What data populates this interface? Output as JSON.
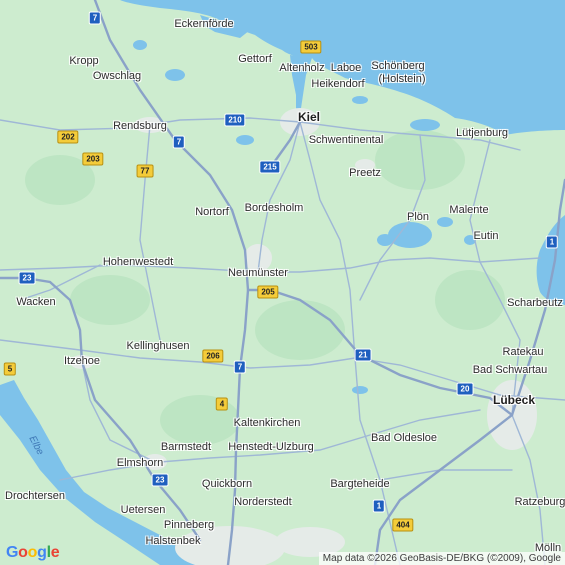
{
  "map": {
    "places": {
      "eckernfoerde": "Eckernförde",
      "kropp": "Kropp",
      "owschlag": "Owschlag",
      "gettorf": "Gettorf",
      "altenholz": "Altenholz",
      "laboe": "Laboe",
      "schoenberg": "Schönberg",
      "schoenberg_sub": "(Holstein)",
      "heikendorf": "Heikendorf",
      "rendsburg": "Rendsburg",
      "kiel": "Kiel",
      "schwentinental": "Schwentinental",
      "luetjenburg": "Lütjenburg",
      "preetz": "Preetz",
      "nortorf": "Nortorf",
      "bordesholm": "Bordesholm",
      "ploen": "Plön",
      "malente": "Malente",
      "eutin": "Eutin",
      "hohenwestedt": "Hohenwestedt",
      "neumuenster": "Neumünster",
      "wacken": "Wacken",
      "scharbeutz": "Scharbeutz",
      "kellinghusen": "Kellinghusen",
      "itzehoe": "Itzehoe",
      "ratekau": "Ratekau",
      "bad_schwartau": "Bad Schwartau",
      "luebeck": "Lübeck",
      "kaltenkirchen": "Kaltenkirchen",
      "bad_oldesloe": "Bad Oldesloe",
      "barmstedt": "Barmstedt",
      "henstedt_ulzburg": "Henstedt-Ulzburg",
      "elmshorn": "Elmshorn",
      "quickborn": "Quickborn",
      "bargteheide": "Bargteheide",
      "drochtersen": "Drochtersen",
      "norderstedt": "Norderstedt",
      "uetersen": "Uetersen",
      "pinneberg": "Pinneberg",
      "ratzeburg": "Ratzeburg",
      "halstenbek": "Halstenbek",
      "moelln": "Mölln"
    },
    "water_label": "Elbe",
    "shields": {
      "r7a": "7",
      "r503": "503",
      "r202": "202",
      "r210": "210",
      "r7b": "7",
      "r203": "203",
      "r215": "215",
      "r77": "77",
      "r1a": "1",
      "r23a": "23",
      "r205": "205",
      "r5": "5",
      "r206": "206",
      "r21": "21",
      "r7c": "7",
      "r20": "20",
      "r4": "4",
      "r23b": "23",
      "r1b": "1",
      "r404": "404"
    },
    "colors": {
      "land": "#cdeccf",
      "water": "#7ec2ea",
      "road": "#9fb7d6",
      "motorway": "#8aa2c8",
      "urban": "#e5ebe8"
    }
  },
  "footer": {
    "logo": "Google",
    "attribution": "Map data ©2026 GeoBasis-DE/BKG (©2009), Google"
  }
}
